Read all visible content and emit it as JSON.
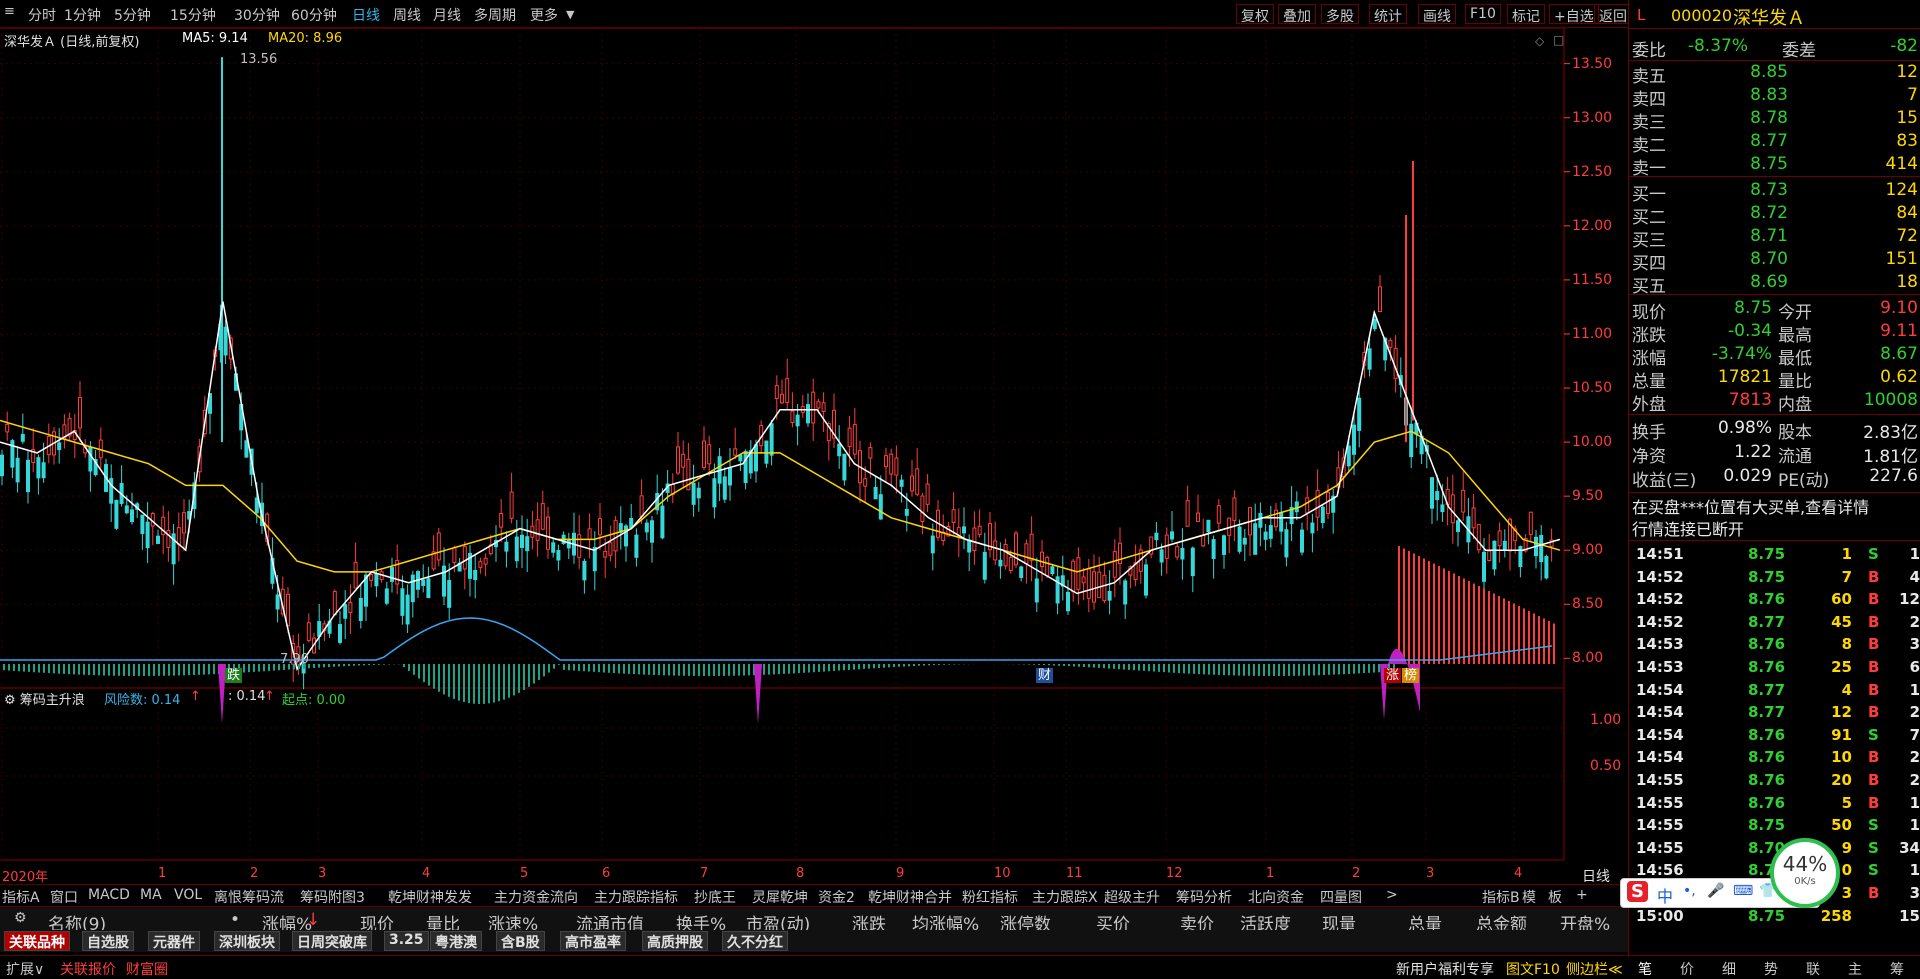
{
  "topbar": {
    "periods": [
      "分时",
      "1分钟",
      "5分钟",
      "15分钟",
      "30分钟",
      "60分钟",
      "日线",
      "周线",
      "月线",
      "多周期",
      "更多"
    ],
    "active_period": "日线",
    "right_buttons": [
      "复权",
      "叠加",
      "多股",
      "统计",
      "画线",
      "F10",
      "标记",
      "+自选",
      "返回"
    ]
  },
  "chart": {
    "title": "深华发Ａ (日线,前复权)",
    "ma5_label": "MA5: 9.14",
    "ma20_label": "MA20: 8.96",
    "high_marker": "13.56",
    "low_marker": "7.90",
    "badges": [
      "跌",
      "财",
      "涨",
      "榜"
    ],
    "y_ticks": [
      "13.50",
      "13.00",
      "12.50",
      "12.00",
      "11.50",
      "11.00",
      "10.50",
      "10.00",
      "9.50",
      "9.00",
      "8.50",
      "8.00"
    ],
    "colors": {
      "up": "#ff3c3c",
      "down": "#35d8d8",
      "ma5": "#ffffff",
      "ma20": "#ffd800"
    }
  },
  "chart_data": {
    "type": "line",
    "title": "深华发Ａ (日线,前复权)",
    "y_range": [
      7.8,
      13.7
    ],
    "series": [
      {
        "name": "MA5",
        "values": [
          10.0,
          9.9,
          10.1,
          9.6,
          9.3,
          9.0,
          11.3,
          9.4,
          7.9,
          8.4,
          8.8,
          8.7,
          8.8,
          9.0,
          9.2,
          9.1,
          9.0,
          9.2,
          9.6,
          9.7,
          9.8,
          10.3,
          10.3,
          9.8,
          9.6,
          9.3,
          9.1,
          9.0,
          8.8,
          8.6,
          8.7,
          9.0,
          9.1,
          9.2,
          9.3,
          9.3,
          9.5,
          11.2,
          10.3,
          9.4,
          9.0,
          9.0,
          9.1
        ]
      },
      {
        "name": "MA20",
        "values": [
          10.2,
          10.1,
          10.0,
          9.9,
          9.8,
          9.6,
          9.6,
          9.3,
          8.9,
          8.8,
          8.8,
          8.9,
          9.0,
          9.1,
          9.2,
          9.1,
          9.1,
          9.2,
          9.5,
          9.7,
          9.9,
          9.9,
          9.7,
          9.5,
          9.3,
          9.2,
          9.1,
          9.0,
          8.9,
          8.8,
          8.9,
          9.0,
          9.1,
          9.2,
          9.3,
          9.4,
          9.6,
          10.0,
          10.1,
          9.9,
          9.5,
          9.1,
          9.0
        ]
      }
    ],
    "x_ticks": [
      "2020年",
      "1",
      "2",
      "3",
      "4",
      "5",
      "6",
      "7",
      "8",
      "9",
      "10",
      "11",
      "12",
      "1",
      "2",
      "3",
      "4"
    ],
    "indicator": {
      "name": "筹码主升浪",
      "risk_label": "风险数: 0.14",
      "value_label": ": 0.14",
      "start_label": "起点: 0.00",
      "y_ticks": [
        "1.00",
        "0.50"
      ]
    }
  },
  "quote": {
    "code": "000020",
    "name": "深华发Ａ",
    "weibi_label": "委比",
    "weibi": "-8.37%",
    "weicha_label": "委差",
    "weicha": "-82",
    "asks": [
      {
        "label": "卖五",
        "price": "8.85",
        "vol": "12"
      },
      {
        "label": "卖四",
        "price": "8.83",
        "vol": "7"
      },
      {
        "label": "卖三",
        "price": "8.78",
        "vol": "15"
      },
      {
        "label": "卖二",
        "price": "8.77",
        "vol": "83"
      },
      {
        "label": "卖一",
        "price": "8.75",
        "vol": "414"
      }
    ],
    "bids": [
      {
        "label": "买一",
        "price": "8.73",
        "vol": "124"
      },
      {
        "label": "买二",
        "price": "8.72",
        "vol": "84"
      },
      {
        "label": "买三",
        "price": "8.71",
        "vol": "72"
      },
      {
        "label": "买四",
        "price": "8.70",
        "vol": "151"
      },
      {
        "label": "买五",
        "price": "8.69",
        "vol": "18"
      }
    ],
    "stats": [
      {
        "l1": "现价",
        "v1": "8.75",
        "l2": "今开",
        "v2": "9.10"
      },
      {
        "l1": "涨跌",
        "v1": "-0.34",
        "l2": "最高",
        "v2": "9.11"
      },
      {
        "l1": "涨幅",
        "v1": "-3.74%",
        "l2": "最低",
        "v2": "8.67"
      },
      {
        "l1": "总量",
        "v1": "17821",
        "l2": "量比",
        "v2": "0.62"
      },
      {
        "l1": "外盘",
        "v1": "7813",
        "l2": "内盘",
        "v2": "10008"
      }
    ],
    "stats2": [
      {
        "l1": "换手",
        "v1": "0.98%",
        "l2": "股本",
        "v2": "2.83亿"
      },
      {
        "l1": "净资",
        "v1": "1.22",
        "l2": "流通",
        "v2": "1.81亿"
      },
      {
        "l1": "收益(三)",
        "v1": "0.029",
        "l2": "PE(动)",
        "v2": "227.6"
      }
    ],
    "notice": "在买盘***位置有大买单,查看详情",
    "disconnected": "行情连接已断开",
    "ticks": [
      {
        "t": "14:51",
        "p": "8.75",
        "v": "1",
        "s": "S",
        "n": "1"
      },
      {
        "t": "14:52",
        "p": "8.75",
        "v": "7",
        "s": "B",
        "n": "4"
      },
      {
        "t": "14:52",
        "p": "8.76",
        "v": "60",
        "s": "B",
        "n": "12"
      },
      {
        "t": "14:52",
        "p": "8.77",
        "v": "45",
        "s": "B",
        "n": "2"
      },
      {
        "t": "14:53",
        "p": "8.76",
        "v": "8",
        "s": "B",
        "n": "3"
      },
      {
        "t": "14:53",
        "p": "8.76",
        "v": "25",
        "s": "B",
        "n": "6"
      },
      {
        "t": "14:54",
        "p": "8.77",
        "v": "4",
        "s": "B",
        "n": "1"
      },
      {
        "t": "14:54",
        "p": "8.77",
        "v": "12",
        "s": "B",
        "n": "2"
      },
      {
        "t": "14:54",
        "p": "8.76",
        "v": "91",
        "s": "S",
        "n": "7"
      },
      {
        "t": "14:54",
        "p": "8.76",
        "v": "10",
        "s": "B",
        "n": "2"
      },
      {
        "t": "14:55",
        "p": "8.76",
        "v": "20",
        "s": "B",
        "n": "2"
      },
      {
        "t": "14:55",
        "p": "8.76",
        "v": "5",
        "s": "B",
        "n": "1"
      },
      {
        "t": "14:55",
        "p": "8.75",
        "v": "50",
        "s": "S",
        "n": "1"
      },
      {
        "t": "14:55",
        "p": "8.70",
        "v": "9",
        "s": "S",
        "n": "34"
      },
      {
        "t": "14:56",
        "p": "8.70",
        "v": "0",
        "s": "S",
        "n": "1"
      },
      {
        "t": "14:56",
        "p": "8.70",
        "v": "3",
        "s": "B",
        "n": "3"
      },
      {
        "t": "15:00",
        "p": "8.75",
        "v": "258",
        "s": "",
        "n": "15"
      }
    ],
    "bottom_tabs": [
      "笔",
      "价",
      "细",
      "势",
      "联",
      "主",
      "筹"
    ]
  },
  "indicator_tabs": [
    "指标A",
    "窗口",
    "MACD",
    "MA",
    "VOL",
    "离恨筹码流",
    "筹码附图3",
    "乾坤财神发发",
    "主力资金流向",
    "主力跟踪指标",
    "抄底王",
    "灵犀乾坤",
    "资金2",
    "乾坤财神合并",
    "粉红指标",
    "主力跟踪X",
    "超级主升",
    "筹码分析",
    "北向资金",
    "四量图",
    ">",
    "指标B",
    "模",
    "板",
    "+"
  ],
  "range_label": "日线",
  "columns": [
    "名称(9)",
    "•",
    "涨幅%",
    "现价",
    "量比",
    "涨速%",
    "流通市值",
    "换手%",
    "市盈(动)",
    "涨跌",
    "均涨幅%",
    "涨停数",
    "买价",
    "卖价",
    "活跃度",
    "现量",
    "总量",
    "总金额",
    "开盘%"
  ],
  "sector_tabs": [
    "关联品种",
    "自选股",
    "元器件",
    "深圳板块",
    "日周突破库",
    "3.25",
    "粤港澳",
    "含B股",
    "高市盈率",
    "高质押股",
    "久不分红"
  ],
  "bottom": {
    "items": [
      "扩展∨",
      "关联报价",
      "财富圈"
    ],
    "news": "新用户福利专享",
    "f10": "图文F10",
    "sidebar": "侧边栏≪"
  },
  "overlay": {
    "percent": "44%",
    "speed": "0K/s",
    "ime": "中"
  }
}
